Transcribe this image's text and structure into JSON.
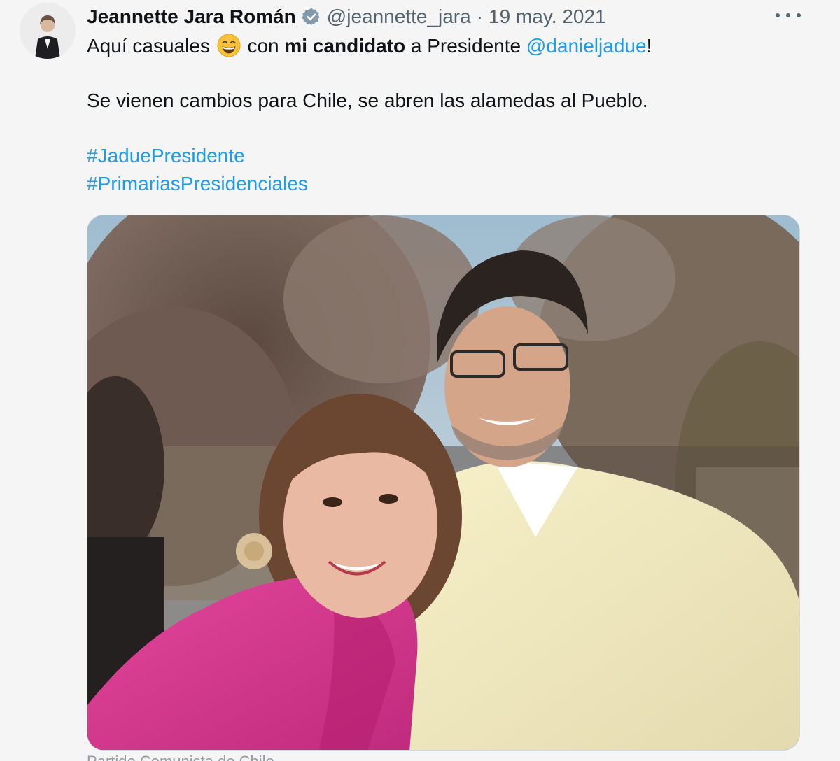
{
  "author": {
    "name": "Jeannette Jara Román",
    "handle": "@jeannette_jara",
    "separator": "·",
    "date": "19 may. 2021"
  },
  "tweet": {
    "line1_a": "Aquí casuales",
    "line1_b": "con",
    "line1_bold": "mi candidato",
    "line1_c": "a Presidente",
    "mention": "@danieljadue",
    "line1_end": "!",
    "line2": "Se vienen cambios para Chile, se abren las alamedas al Pueblo.",
    "hashtags": [
      "#JaduePresidente",
      "#PrimariasPresidenciales"
    ]
  },
  "media_caption": "Partido Comunista de Chile",
  "icons": {
    "verified": "verified-badge-icon",
    "more": "more-options-icon",
    "emoji": "grinning-face-emoji"
  },
  "colors": {
    "link": "#1d9bf0",
    "secondary_text": "#536471",
    "verified_badge": "#829aab"
  }
}
